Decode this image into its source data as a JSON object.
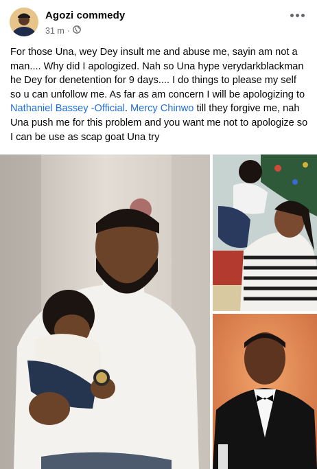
{
  "post": {
    "author": "Agozi commedy",
    "time": "31 m",
    "separator": "·",
    "audience_icon": "globe-icon",
    "more_icon": "more-options-icon",
    "text_before_mention_1": "For those Una, wey Dey insult me and abuse me, sayin am not a man.... Why did I apologized. Nah so Una hype verydarkblackman he Dey for denetention for 9 days.... I do things to please my self so u can unfollow me. As far as am concern I will be apologizing to ",
    "mention_1": "Nathaniel Bassey -Official",
    "text_between_mentions": ". ",
    "mention_2": "Mercy Chinwo",
    "text_after_mention_2": " till they forgive me, nah Una push me for this problem and you want me not to apologize so I can be use as scap goat Una try"
  },
  "colors": {
    "mention": "#216fdb",
    "secondary_text": "#65676b",
    "primary_text": "#050505"
  },
  "photos": [
    {
      "name": "photo-man-holding-baby"
    },
    {
      "name": "photo-woman-lifting-child"
    },
    {
      "name": "photo-man-in-tuxedo"
    }
  ]
}
